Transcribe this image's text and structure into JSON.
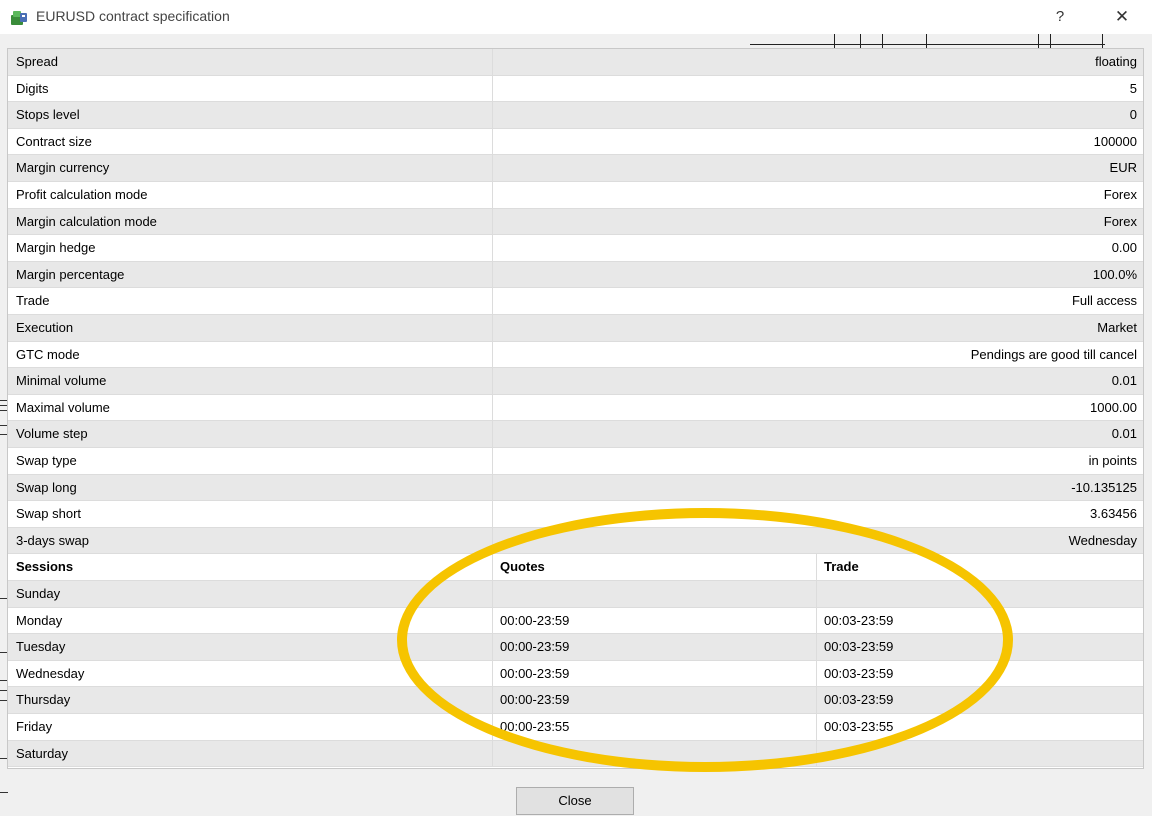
{
  "window": {
    "title": "EURUSD contract specification",
    "help_label": "?",
    "close_label": "✕"
  },
  "specs": [
    {
      "name": "Spread",
      "value": "floating"
    },
    {
      "name": "Digits",
      "value": "5"
    },
    {
      "name": "Stops level",
      "value": "0"
    },
    {
      "name": "Contract size",
      "value": "100000"
    },
    {
      "name": "Margin currency",
      "value": "EUR"
    },
    {
      "name": "Profit calculation mode",
      "value": "Forex"
    },
    {
      "name": "Margin calculation mode",
      "value": "Forex"
    },
    {
      "name": "Margin hedge",
      "value": "0.00"
    },
    {
      "name": "Margin percentage",
      "value": "100.0%"
    },
    {
      "name": "Trade",
      "value": "Full access"
    },
    {
      "name": "Execution",
      "value": "Market"
    },
    {
      "name": "GTC mode",
      "value": "Pendings are good till cancel"
    },
    {
      "name": "Minimal volume",
      "value": "0.01"
    },
    {
      "name": "Maximal volume",
      "value": "1000.00"
    },
    {
      "name": "Volume step",
      "value": "0.01"
    },
    {
      "name": "Swap type",
      "value": "in points"
    },
    {
      "name": "Swap long",
      "value": "-10.135125"
    },
    {
      "name": "Swap short",
      "value": "3.63456"
    },
    {
      "name": "3-days swap",
      "value": "Wednesday"
    }
  ],
  "sessions_header": {
    "day": "Sessions",
    "quotes": "Quotes",
    "trade": "Trade"
  },
  "sessions": [
    {
      "day": "Sunday",
      "quotes": "",
      "trade": ""
    },
    {
      "day": "Monday",
      "quotes": "00:00-23:59",
      "trade": "00:03-23:59"
    },
    {
      "day": "Tuesday",
      "quotes": "00:00-23:59",
      "trade": "00:03-23:59"
    },
    {
      "day": "Wednesday",
      "quotes": "00:00-23:59",
      "trade": "00:03-23:59"
    },
    {
      "day": "Thursday",
      "quotes": "00:00-23:59",
      "trade": "00:03-23:59"
    },
    {
      "day": "Friday",
      "quotes": "00:00-23:55",
      "trade": "00:03-23:55"
    },
    {
      "day": "Saturday",
      "quotes": "",
      "trade": ""
    }
  ],
  "buttons": {
    "close_label": "Close"
  },
  "colors": {
    "highlight": "#f6c400",
    "row_alt": "#e8e8e8"
  }
}
